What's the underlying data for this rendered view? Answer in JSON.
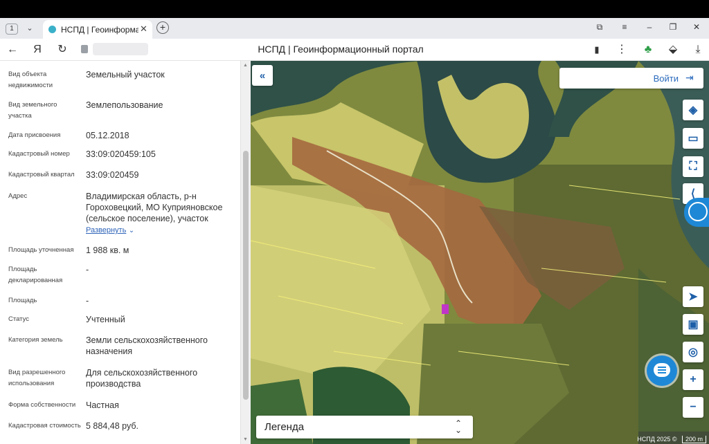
{
  "browser": {
    "tab_count": "1",
    "tab_title": "НСПД | Геоинформационный портал",
    "page_title": "НСПД | Геоинформационный портал"
  },
  "details": [
    {
      "label": "Вид объекта недвижимости",
      "value": "Земельный участок"
    },
    {
      "label": "Вид земельного участка",
      "value": "Землепользование"
    },
    {
      "label": "Дата присвоения",
      "value": "05.12.2018"
    },
    {
      "label": "Кадастровый номер",
      "value": "33:09:020459:105"
    },
    {
      "label": "Кадастровый квартал",
      "value": "33:09:020459"
    },
    {
      "label": "Адрес",
      "value": "Владимирская область, р-н Гороховецкий, МО Куприяновское (сельское поселение), участок",
      "link": "Развернуть"
    },
    {
      "label": "Площадь уточненная",
      "value": "1 988 кв. м"
    },
    {
      "label": "Площадь декларированная",
      "value": "-"
    },
    {
      "label": "Площадь",
      "value": "-"
    },
    {
      "label": "Статус",
      "value": "Учтенный"
    },
    {
      "label": "Категория земель",
      "value": "Земли сельскохозяйственного назначения"
    },
    {
      "label": "Вид разрешенного использования",
      "value": "Для сельскохозяйственного производства"
    },
    {
      "label": "Форма собственности",
      "value": "Частная"
    },
    {
      "label": "Кадастровая стоимость",
      "value": "5 884,48 руб."
    }
  ],
  "map": {
    "login_label": "Войти",
    "legend_label": "Легенда",
    "copyright": "НСПД 2025 ©",
    "scale_label": "200 m"
  },
  "icons": {
    "collapse": "double-chevron-left-icon",
    "layers": "layers-icon",
    "ruler": "ruler-icon",
    "select": "select-area-icon",
    "share": "share-icon",
    "locate": "navigation-arrow-icon",
    "screen": "screen-icon",
    "geo": "geo-pin-icon",
    "zoom_in": "plus-icon",
    "zoom_out": "minus-icon"
  }
}
